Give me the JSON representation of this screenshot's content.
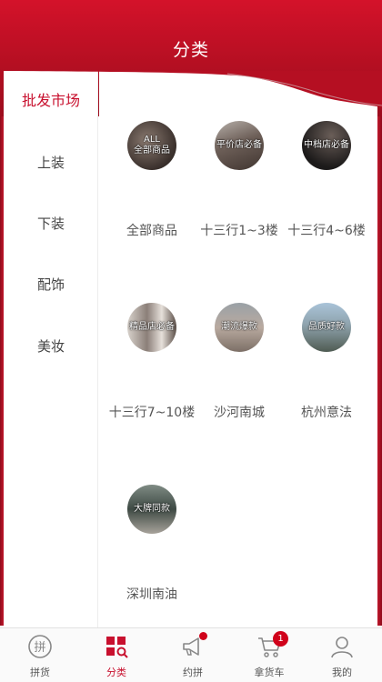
{
  "header": {
    "title": "分类"
  },
  "sidebar": {
    "items": [
      {
        "label": "批发市场",
        "active": true
      },
      {
        "label": "上装",
        "active": false
      },
      {
        "label": "下装",
        "active": false
      },
      {
        "label": "配饰",
        "active": false
      },
      {
        "label": "美妆",
        "active": false
      }
    ]
  },
  "categories": [
    {
      "label": "全部商品",
      "thumb_line1": "ALL",
      "thumb_line2": "全部商品"
    },
    {
      "label": "十三行1~3楼",
      "thumb_line1": "平价店必备"
    },
    {
      "label": "十三行4~6楼",
      "thumb_line1": "中档店必备"
    },
    {
      "label": "十三行7~10楼",
      "thumb_line1": "精品店必备"
    },
    {
      "label": "沙河南城",
      "thumb_line1": "潮流爆款"
    },
    {
      "label": "杭州意法",
      "thumb_line1": "品质好款"
    },
    {
      "label": "深圳南油",
      "thumb_line1": "大牌同款"
    }
  ],
  "tabbar": {
    "tabs": [
      {
        "label": "拼货",
        "icon": "pin-circle-icon",
        "active": false
      },
      {
        "label": "分类",
        "icon": "category-grid-icon",
        "active": true
      },
      {
        "label": "约拼",
        "icon": "megaphone-icon",
        "active": false,
        "dot": true
      },
      {
        "label": "拿货车",
        "icon": "cart-icon",
        "active": false,
        "badge": "1"
      },
      {
        "label": "我的",
        "icon": "user-icon",
        "active": false
      }
    ]
  },
  "colors": {
    "accent": "#c8102e",
    "header": "#c8102e",
    "badge": "#d0021b"
  }
}
